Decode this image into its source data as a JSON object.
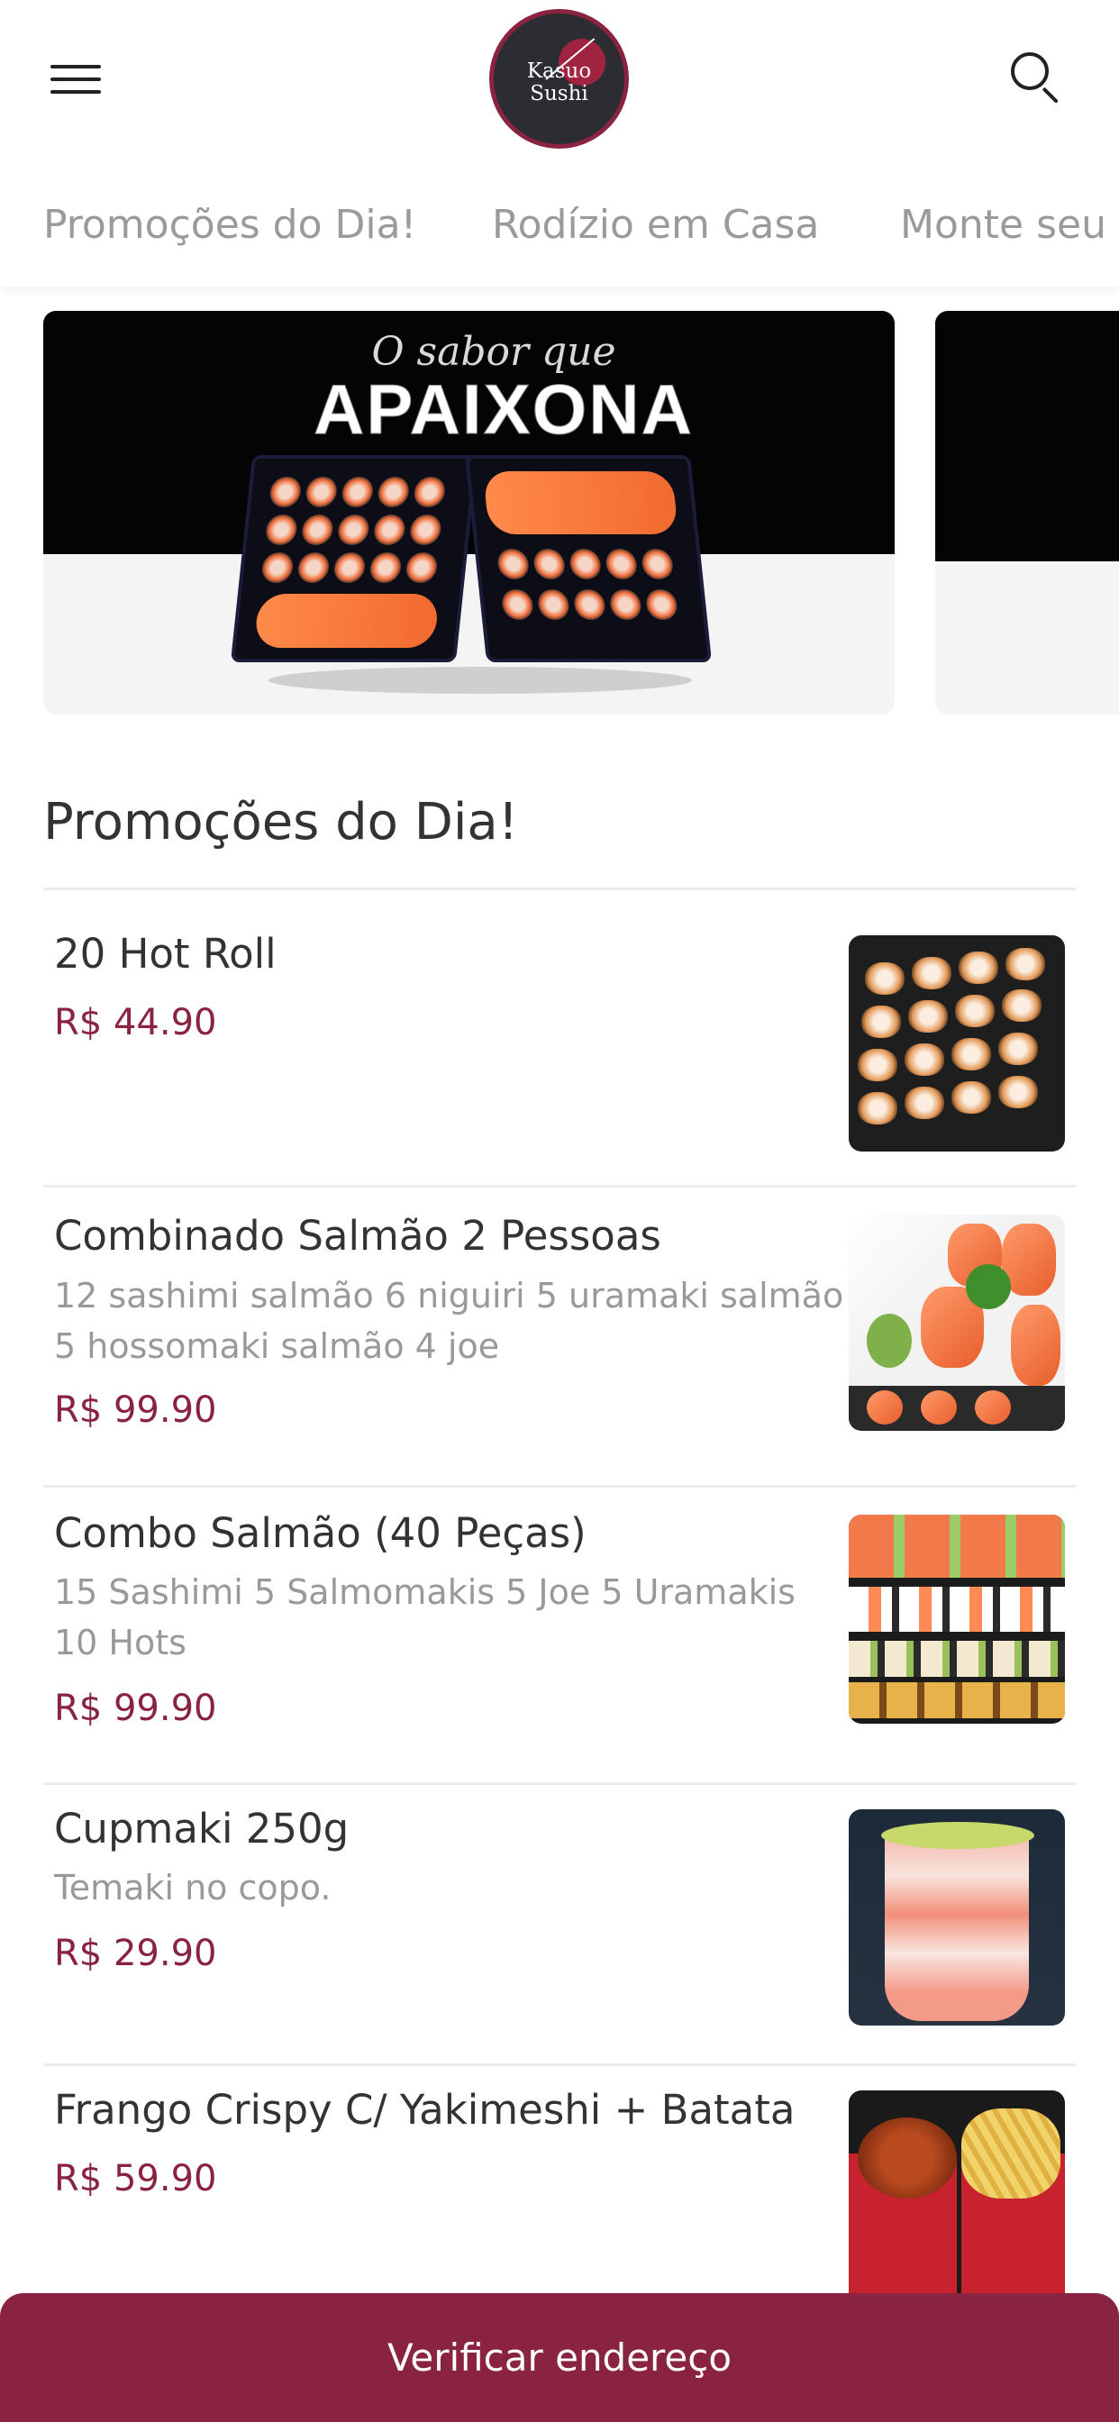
{
  "brand": {
    "logo_line1": "Kasuo",
    "logo_line2": "Sushi"
  },
  "colors": {
    "accent": "#8a2340",
    "price": "#8a2340",
    "tab_text": "#9a9a9a",
    "desc_text": "#999999"
  },
  "header": {
    "menu_icon": "hamburger-menu-icon",
    "search_icon": "search-icon"
  },
  "tabs": [
    {
      "label": "Promoções do Dia!"
    },
    {
      "label": "Rodízio em Casa"
    },
    {
      "label": "Monte seu C"
    }
  ],
  "banner": {
    "tagline_script": "O sabor que",
    "tagline_bold": "APAIXONA"
  },
  "section": {
    "title": "Promoções do Dia!"
  },
  "items": [
    {
      "name": "20 Hot Roll",
      "description": "",
      "price": "R$ 44.90"
    },
    {
      "name": "Combinado Salmão 2 Pessoas",
      "description": "12 sashimi salmão 6 niguiri 5 uramaki salmão 5 hossomaki salmão 4 joe",
      "price": "R$ 99.90"
    },
    {
      "name": "Combo Salmão (40 Peças)",
      "description": "15 Sashimi 5 Salmomakis 5 Joe 5 Uramakis 10 Hots",
      "price": "R$ 99.90"
    },
    {
      "name": "Cupmaki 250g",
      "description": "Temaki no copo.",
      "price": "R$ 29.90"
    },
    {
      "name": "Frango Crispy C/ Yakimeshi + Batata",
      "description": "",
      "price": "R$ 59.90"
    }
  ],
  "cta": {
    "label": "Verificar endereço"
  }
}
